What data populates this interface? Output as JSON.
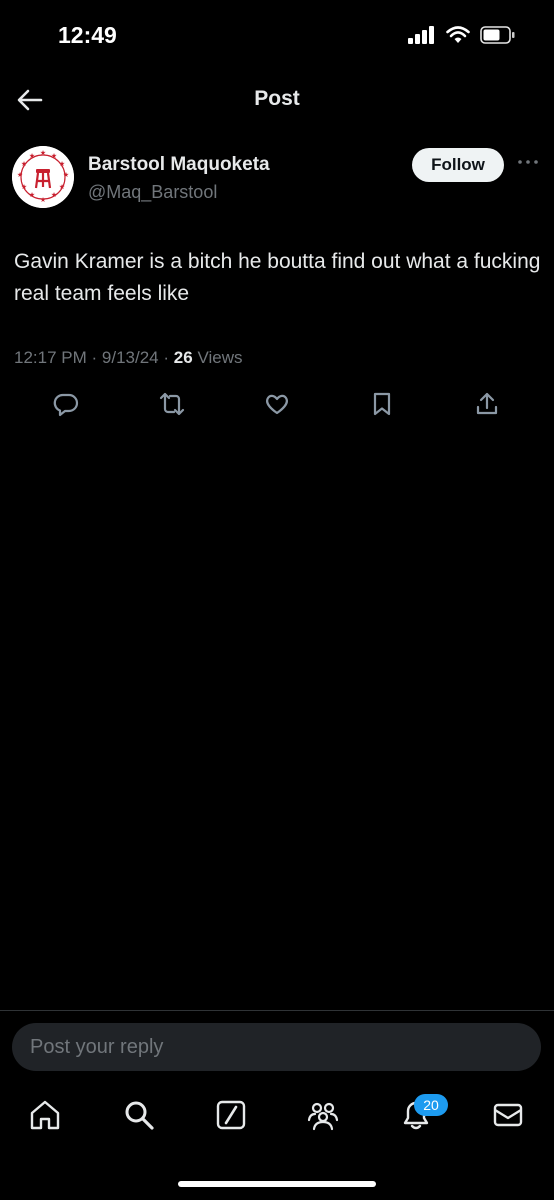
{
  "status": {
    "time": "12:49",
    "icons": [
      "signal-icon",
      "wifi-icon",
      "battery-icon"
    ]
  },
  "header": {
    "back_icon": "arrow-left-icon",
    "title": "Post"
  },
  "post": {
    "display_name": "Barstool Maquoketa",
    "handle": "@Maq_Barstool",
    "follow_label": "Follow",
    "more_icon": "more-icon",
    "text": "Gavin Kramer is a bitch he boutta find out what a fucking real team feels like",
    "time": "12:17 PM",
    "date": "9/13/24",
    "views_count": "26",
    "views_label": "Views",
    "separator": "·"
  },
  "actions": [
    "reply-icon",
    "repost-icon",
    "like-icon",
    "bookmark-icon",
    "share-icon"
  ],
  "reply": {
    "placeholder": "Post your reply"
  },
  "tabbar": {
    "items": [
      "home-icon",
      "search-icon",
      "grok-icon",
      "communities-icon",
      "notifications-icon",
      "messages-icon"
    ],
    "notifications_badge": "20"
  },
  "colors": {
    "background": "#000000",
    "text": "#e7e9ea",
    "secondary": "#71767b",
    "accent": "#1d9bf0",
    "brand_red": "#c8202f"
  }
}
